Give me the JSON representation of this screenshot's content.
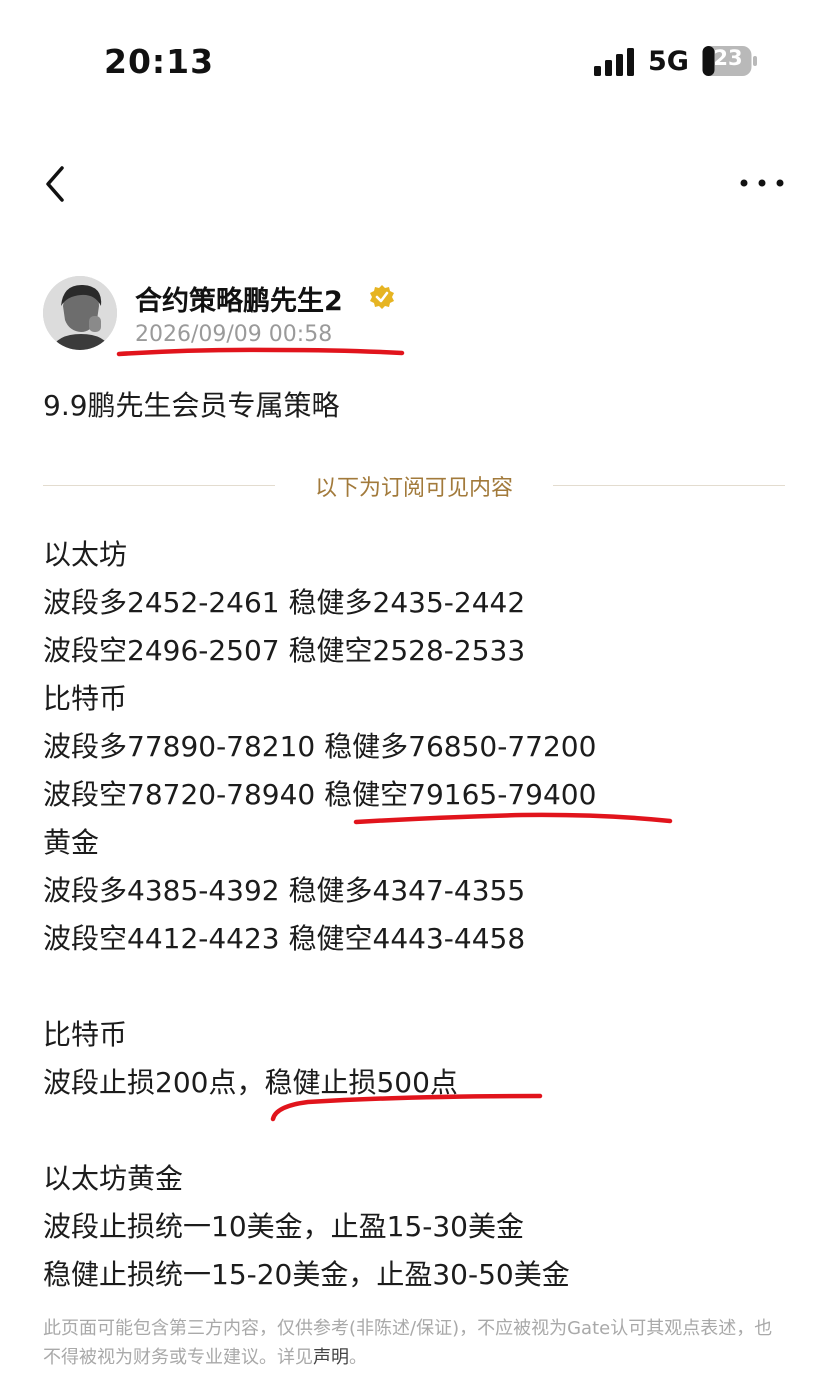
{
  "status_bar": {
    "time": "20:13",
    "network": "5G",
    "battery": "23"
  },
  "post": {
    "author": "合约策略鹏先生2",
    "timestamp": "2026/09/09 00:58",
    "title": "9.9鹏先生会员专属策略",
    "divider_label": "以下为订阅可见内容",
    "lines": [
      "以太坊",
      "波段多2452-2461 稳健多2435-2442",
      "波段空2496-2507 稳健空2528-2533",
      "比特币",
      "波段多77890-78210 稳健多76850-77200",
      "波段空78720-78940 稳健空79165-79400",
      "黄金",
      "波段多4385-4392 稳健多4347-4355",
      "波段空4412-4423 稳健空4443-4458",
      "比特币",
      "波段止损200点，稳健止损500点",
      "以太坊黄金",
      "波段止损统一10美金，止盈15-30美金",
      "稳健止损统一15-20美金，止盈30-50美金"
    ]
  },
  "disclaimer": {
    "text": "此页面可能包含第三方内容，仅供参考(非陈述/保证)，不应被视为Gate认可其观点表述，也不得被视为财务或专业建议。详见",
    "link": "声明",
    "end": "。"
  },
  "colors": {
    "accent": "#a27a3b",
    "verified": "#e6b422",
    "annotation": "#e1141c"
  },
  "icons": [
    "signal-icon",
    "battery-icon",
    "back-icon",
    "more-icon",
    "verified-icon"
  ]
}
